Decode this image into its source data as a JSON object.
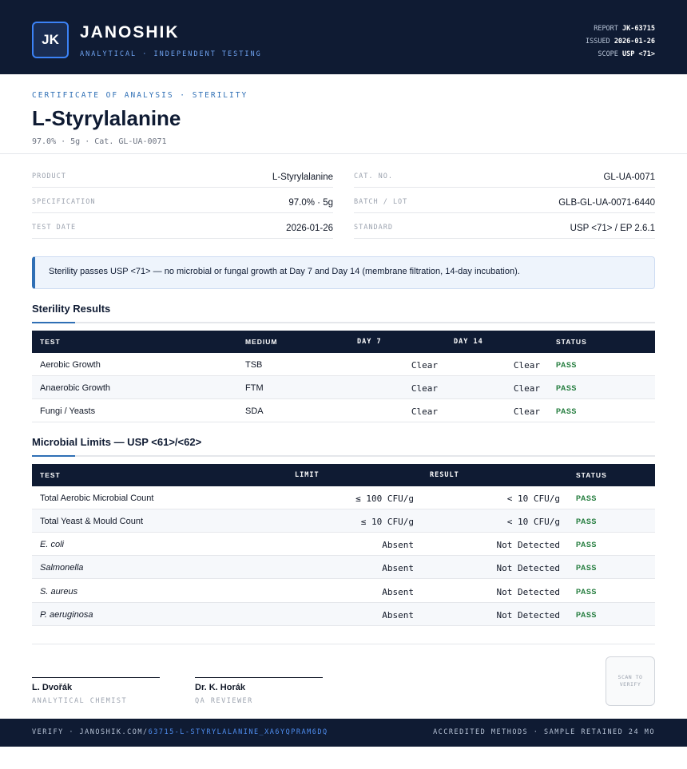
{
  "header": {
    "logo_initials": "JK",
    "brand": "JANOSHIK",
    "tagline": "ANALYTICAL · INDEPENDENT TESTING",
    "report_label": "REPORT",
    "report_value": "JK-63715",
    "issued_label": "ISSUED",
    "issued_value": "2026-01-26",
    "scope_label": "SCOPE",
    "scope_value": "USP <71>"
  },
  "title_block": {
    "kicker": "CERTIFICATE OF ANALYSIS · STERILITY",
    "title": "L-Styrylalanine",
    "subline": "97.0% · 5g  ·  Cat. GL-UA-0071"
  },
  "info": {
    "product_label": "PRODUCT",
    "product_value": "L-Styrylalanine",
    "spec_label": "SPECIFICATION",
    "spec_value": "97.0% · 5g",
    "date_label": "TEST DATE",
    "date_value": "2026-01-26",
    "cat_label": "CAT. NO.",
    "cat_value": "GL-UA-0071",
    "batch_label": "BATCH / LOT",
    "batch_value": "GLB-GL-UA-0071-6440",
    "standard_label": "STANDARD",
    "standard_value": "USP <71> / EP 2.6.1"
  },
  "note": "Sterility passes USP <71> — no microbial or fungal growth at Day 7 and Day 14 (membrane filtration, 14-day incubation).",
  "sterility": {
    "title": "Sterility Results",
    "headers": [
      "TEST",
      "MEDIUM",
      "DAY 7",
      "DAY 14",
      "STATUS"
    ],
    "rows": [
      {
        "test": "Aerobic Growth",
        "medium": "TSB",
        "day7": "Clear",
        "day14": "Clear",
        "status": "PASS"
      },
      {
        "test": "Anaerobic Growth",
        "medium": "FTM",
        "day7": "Clear",
        "day14": "Clear",
        "status": "PASS"
      },
      {
        "test": "Fungi / Yeasts",
        "medium": "SDA",
        "day7": "Clear",
        "day14": "Clear",
        "status": "PASS"
      }
    ]
  },
  "microbial": {
    "title": "Microbial Limits — USP <61>/<62>",
    "headers": [
      "TEST",
      "LIMIT",
      "RESULT",
      "STATUS"
    ],
    "rows": [
      {
        "test": "Total Aerobic Microbial Count",
        "limit": "≤ 100 CFU/g",
        "result": "< 10 CFU/g",
        "status": "PASS"
      },
      {
        "test": "Total Yeast & Mould Count",
        "limit": "≤ 10 CFU/g",
        "result": "< 10 CFU/g",
        "status": "PASS"
      },
      {
        "test": "E. coli",
        "limit": "Absent",
        "result": "Not Detected",
        "status": "PASS"
      },
      {
        "test": "Salmonella",
        "limit": "Absent",
        "result": "Not Detected",
        "status": "PASS"
      },
      {
        "test": "S. aureus",
        "limit": "Absent",
        "result": "Not Detected",
        "status": "PASS"
      },
      {
        "test": "P. aeruginosa",
        "limit": "Absent",
        "result": "Not Detected",
        "status": "PASS"
      }
    ]
  },
  "signatures": {
    "chemist_name": "L. Dvořák",
    "chemist_role": "ANALYTICAL CHEMIST",
    "reviewer_name": "Dr. K. Horák",
    "reviewer_role": "QA REVIEWER",
    "qr_text": "SCAN TO VERIFY"
  },
  "footer": {
    "verify_prefix": "VERIFY · JANOSHIK.COM/",
    "verify_link": "63715-L-STYRYLALANINE_XA6YQPRAM6DQ",
    "right": "ACCREDITED METHODS · SAMPLE RETAINED 24 MO"
  },
  "colors": {
    "navy": "#0f1b33",
    "accent_blue": "#2f6fb5",
    "pass_green": "#1f7a3a"
  }
}
